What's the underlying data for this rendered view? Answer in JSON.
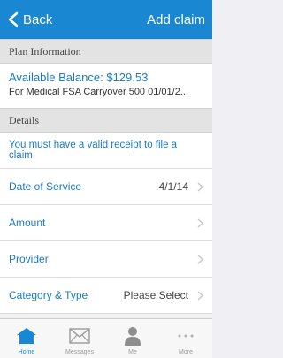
{
  "navbar": {
    "back_label": "Back",
    "action_label": "Add claim"
  },
  "plan_info": {
    "header": "Plan Information",
    "balance": "Available Balance: $129.53",
    "plan_description": "For Medical FSA Carryover 500 01/01/2..."
  },
  "details": {
    "header": "Details",
    "notice": "You must have a valid receipt to file a claim",
    "fields": [
      {
        "label": "Date of Service",
        "value": "4/1/14"
      },
      {
        "label": "Amount",
        "value": ""
      },
      {
        "label": "Provider",
        "value": ""
      },
      {
        "label": "Category & Type",
        "value": "Please Select"
      }
    ]
  },
  "tabbar": {
    "tabs": [
      {
        "label": "Home",
        "icon": "home-icon",
        "active": true
      },
      {
        "label": "Messages",
        "icon": "envelope-icon",
        "active": false
      },
      {
        "label": "Me",
        "icon": "person-icon",
        "active": false
      },
      {
        "label": "More",
        "icon": "more-icon",
        "active": false
      }
    ]
  },
  "colors": {
    "nav_blue": "#1a87d3",
    "link_blue": "#1a7bc4",
    "section_gray": "#e3e3e3"
  }
}
